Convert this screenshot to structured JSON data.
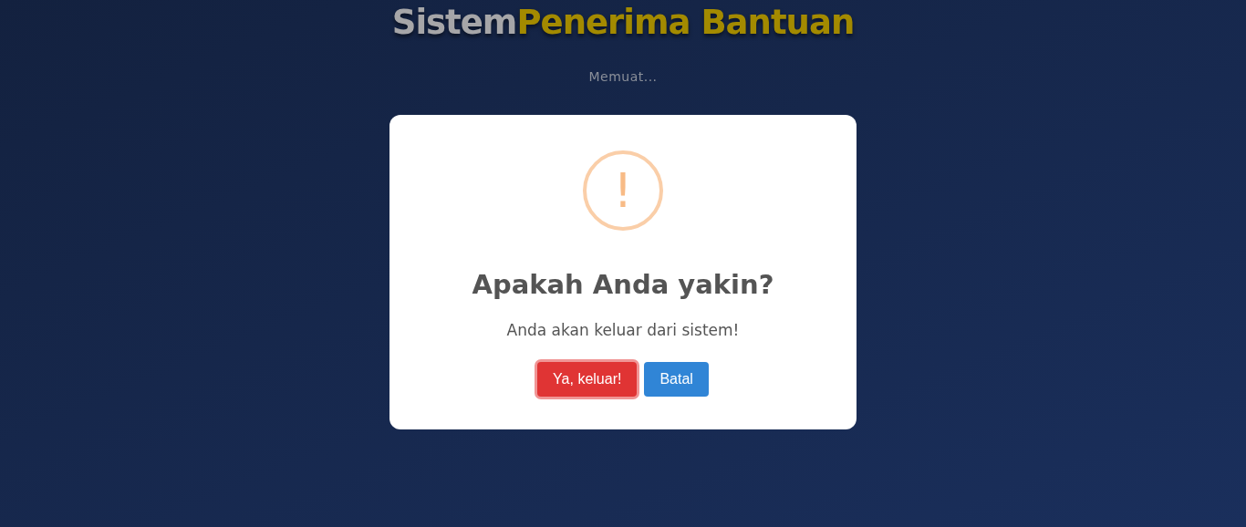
{
  "header": {
    "title_first": "Sistem",
    "title_second": "Penerima Bantuan",
    "status": "Memuat..."
  },
  "dialog": {
    "icon": "!",
    "title": "Apakah Anda yakin?",
    "message": "Anda akan keluar dari sistem!",
    "buttons": [
      {
        "label": "Ya, keluar!",
        "kind": "confirm",
        "focused": true
      },
      {
        "label": "Batal",
        "kind": "cancel",
        "focused": false
      }
    ]
  }
}
